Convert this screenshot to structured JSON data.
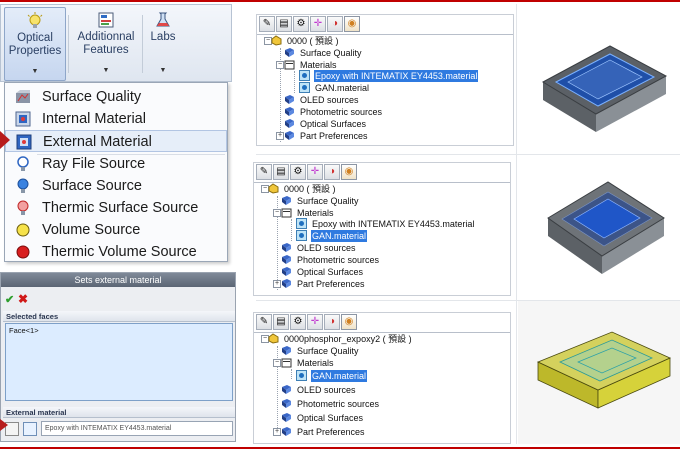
{
  "ribbon": {
    "buttons": [
      {
        "label_line1": "Optical",
        "label_line2": "Properties"
      },
      {
        "label_line1": "Additionnal",
        "label_line2": "Features"
      },
      {
        "label_line1": "Labs",
        "label_line2": ""
      }
    ]
  },
  "menu": {
    "items": [
      {
        "label": "Surface Quality",
        "icon": "surface-quality-icon"
      },
      {
        "label": "Internal Material",
        "icon": "internal-material-icon"
      },
      {
        "label": "External Material",
        "icon": "external-material-icon"
      },
      {
        "label": "Ray File Source",
        "icon": "ray-file-source-icon"
      },
      {
        "label": "Surface Source",
        "icon": "surface-source-icon"
      },
      {
        "label": "Thermic Surface Source",
        "icon": "thermic-surface-source-icon"
      },
      {
        "label": "Volume Source",
        "icon": "volume-source-icon"
      },
      {
        "label": "Thermic Volume Source",
        "icon": "thermic-volume-source-icon"
      }
    ]
  },
  "panel": {
    "title": "Sets external material",
    "selected_faces_label": "Selected faces",
    "selected_faces_value": "Face<1>",
    "external_material_label": "External material",
    "external_material_value": "Epoxy with INTEMATIX EY4453.material"
  },
  "trees": [
    {
      "root": "0000 ( 預設 )",
      "items": {
        "surface_quality": "Surface Quality",
        "materials": "Materials",
        "mat1": "Epoxy with INTEMATIX EY4453.material",
        "mat2": "GAN.material",
        "oled": "OLED sources",
        "photometric": "Photometric sources",
        "optical": "Optical Surfaces",
        "part_prefs": "Part Preferences"
      },
      "selected": "mat1"
    },
    {
      "root": "0000 ( 預設 )",
      "items": {
        "surface_quality": "Surface Quality",
        "materials": "Materials",
        "mat1": "Epoxy with INTEMATIX EY4453.material",
        "mat2": "GAN.material",
        "oled": "OLED sources",
        "photometric": "Photometric sources",
        "optical": "Optical Surfaces",
        "part_prefs": "Part Preferences"
      },
      "selected": "mat2"
    },
    {
      "root": "0000phosphor_expoxy2 ( 預設 )",
      "items": {
        "surface_quality": "Surface Quality",
        "materials": "Materials",
        "mat1": "GAN.material",
        "oled": "OLED sources",
        "photometric": "Photometric sources",
        "optical": "Optical Surfaces",
        "part_prefs": "Part Preferences"
      },
      "selected": "mat1"
    }
  ],
  "colors": {
    "accent_red": "#c00000",
    "selection_blue": "#2f7ae0",
    "model_blue": "#1f4fa8",
    "model_gray": "#6e7378",
    "model_yellow": "#c8c42a"
  }
}
